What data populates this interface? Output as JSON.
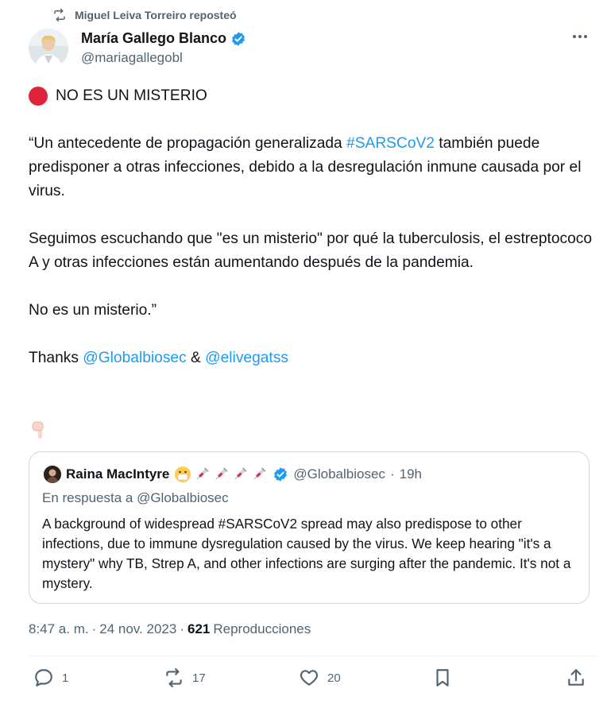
{
  "retweet": {
    "text": "Miguel Leiva Torreiro reposteó",
    "icon": "retweet-icon"
  },
  "author": {
    "name": "María Gallego Blanco",
    "handle": "@mariagallegobl",
    "verified_icon": "verified-badge-icon"
  },
  "tweet": {
    "headline": "NO ES UN MISTERIO",
    "para1_start": "“Un antecedente de propagación generalizada ",
    "para1_hashtag": "#SARSCoV2",
    "para1_end": " también puede predisponer a otras infecciones, debido a la desregulación inmune causada por el virus.",
    "para2": "Seguimos escuchando que \"es un misterio\" por qué la tuberculosis, el estreptococo A y otras infecciones están aumentando después de la pandemia.",
    "para3": "No es un misterio.”",
    "thanks_prefix": "Thanks ",
    "mention1": "@Globalbiosec",
    "amp": " & ",
    "mention2": "@elivegatss"
  },
  "quote": {
    "name": "Raina MacIntyre",
    "handle": "@Globalbiosec",
    "separator": "·",
    "time": "19h",
    "reply_to": "En respuesta a @Globalbiosec",
    "text": "A background of widespread #SARSCoV2 spread may also predispose to other infections, due to immune dysregulation caused by the virus. We keep hearing \"it's a mystery\" why TB, Strep A, and other infections are surging after the pandemic. It's not a mystery."
  },
  "meta": {
    "time": "8:47 a. m.",
    "sep1": "·",
    "date": "24 nov. 2023",
    "sep2": "·",
    "views_count": "621",
    "views_label": "Reproducciones"
  },
  "actions": {
    "replies": "1",
    "reposts": "17",
    "likes": "20"
  },
  "colors": {
    "link": "#1d9bf0",
    "secondary_text": "#536471",
    "verified": "#1d9bf0",
    "red_dot": "#e0243a"
  }
}
